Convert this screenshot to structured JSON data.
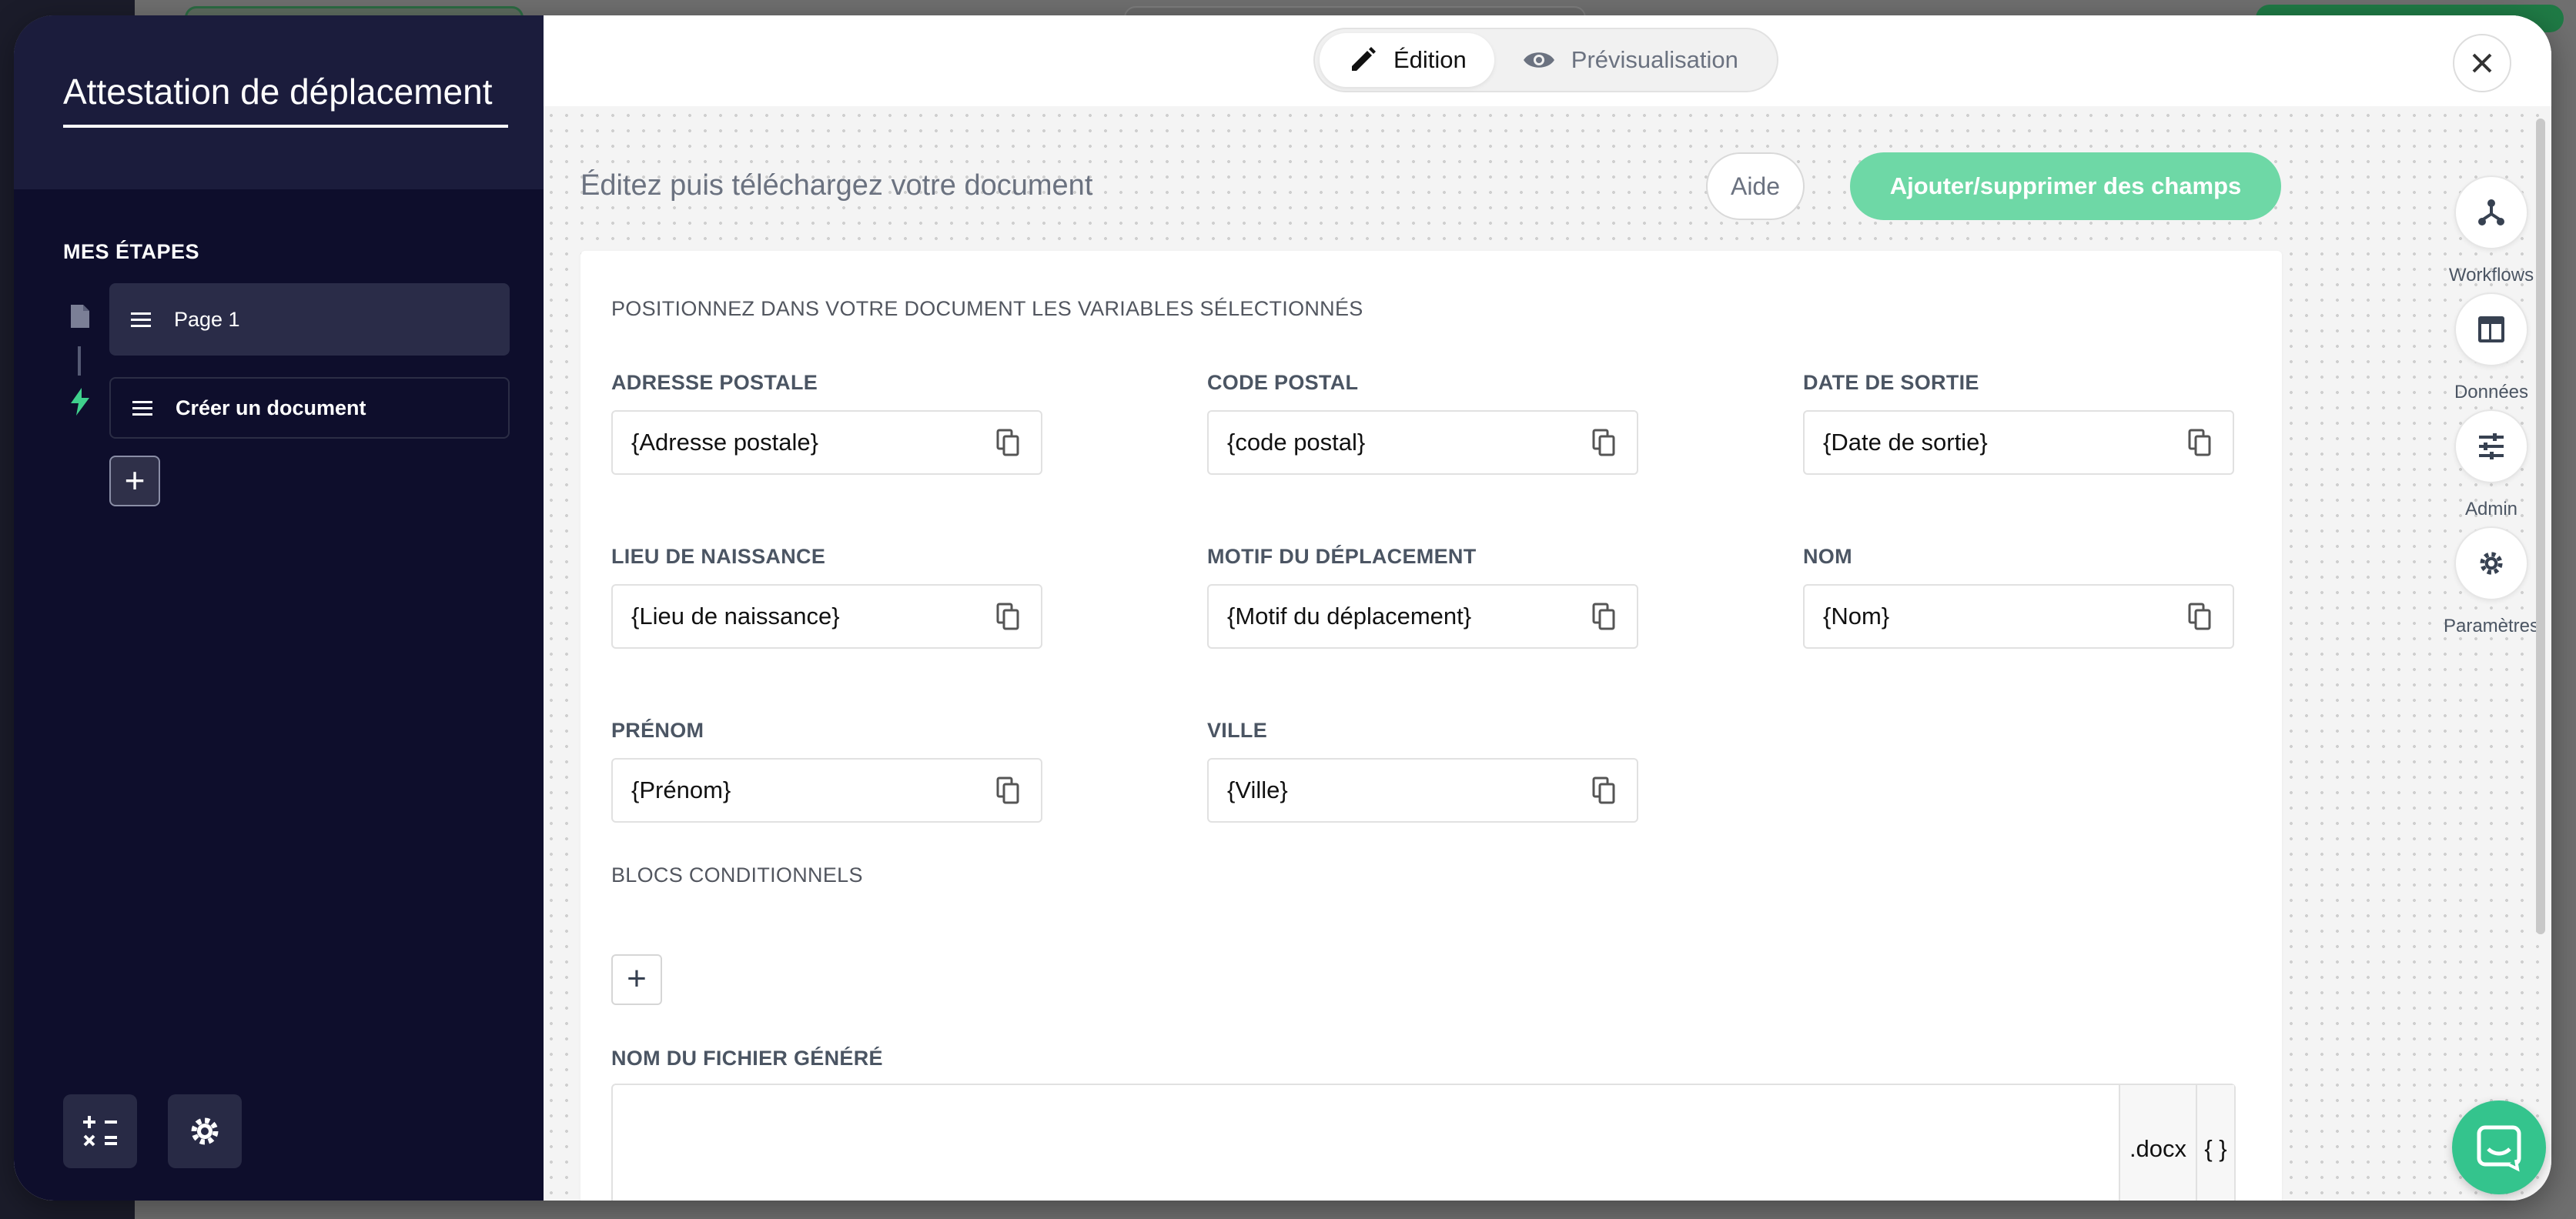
{
  "sidebar": {
    "title": "Attestation de déplacement",
    "steps_label": "MES ÉTAPES",
    "steps": [
      {
        "label": "Page 1",
        "icon": "file-icon"
      },
      {
        "label": "Créer un document",
        "icon": "bolt-icon"
      }
    ],
    "add_step": "+",
    "bottom_buttons": [
      "calculator-icon",
      "gear-icon"
    ]
  },
  "topbar": {
    "modes": [
      {
        "label": "Édition",
        "icon": "pencil-icon",
        "active": true
      },
      {
        "label": "Prévisualisation",
        "icon": "eye-icon",
        "active": false
      }
    ],
    "close_icon": "close-icon"
  },
  "main": {
    "heading": "Éditez puis téléchargez votre document",
    "help_label": "Aide",
    "fields_button_label": "Ajouter/supprimer des champs",
    "card_heading": "POSITIONNEZ DANS VOTRE DOCUMENT LES VARIABLES SÉLECTIONNÉS",
    "variables": [
      {
        "label": "ADRESSE POSTALE",
        "value": "{Adresse postale}"
      },
      {
        "label": "CODE POSTAL",
        "value": "{code postal}"
      },
      {
        "label": "DATE DE SORTIE",
        "value": "{Date de sortie}"
      },
      {
        "label": "LIEU DE NAISSANCE",
        "value": "{Lieu de naissance}"
      },
      {
        "label": "MOTIF DU DÉPLACEMENT",
        "value": "{Motif du déplacement}"
      },
      {
        "label": "NOM",
        "value": "{Nom}"
      },
      {
        "label": "PRÉNOM",
        "value": "{Prénom}"
      },
      {
        "label": "VILLE",
        "value": "{Ville}"
      }
    ],
    "conditional_heading": "BLOCS CONDITIONNELS",
    "conditional_add": "+",
    "filename_heading": "NOM DU FICHIER GÉNÉRÉ",
    "filename_value": "",
    "filename_ext": ".docx",
    "filename_vars": "{ }"
  },
  "rail": [
    {
      "label": "Workflows",
      "icon": "workflow-icon"
    },
    {
      "label": "Données",
      "icon": "table-icon"
    },
    {
      "label": "Admin",
      "icon": "sliders-icon"
    },
    {
      "label": "Paramètres",
      "icon": "gear-icon"
    }
  ],
  "colors": {
    "sidebar_bg": "#0e0e2c",
    "accent_green": "#6ed8a6",
    "chat_green": "#34c48d"
  }
}
